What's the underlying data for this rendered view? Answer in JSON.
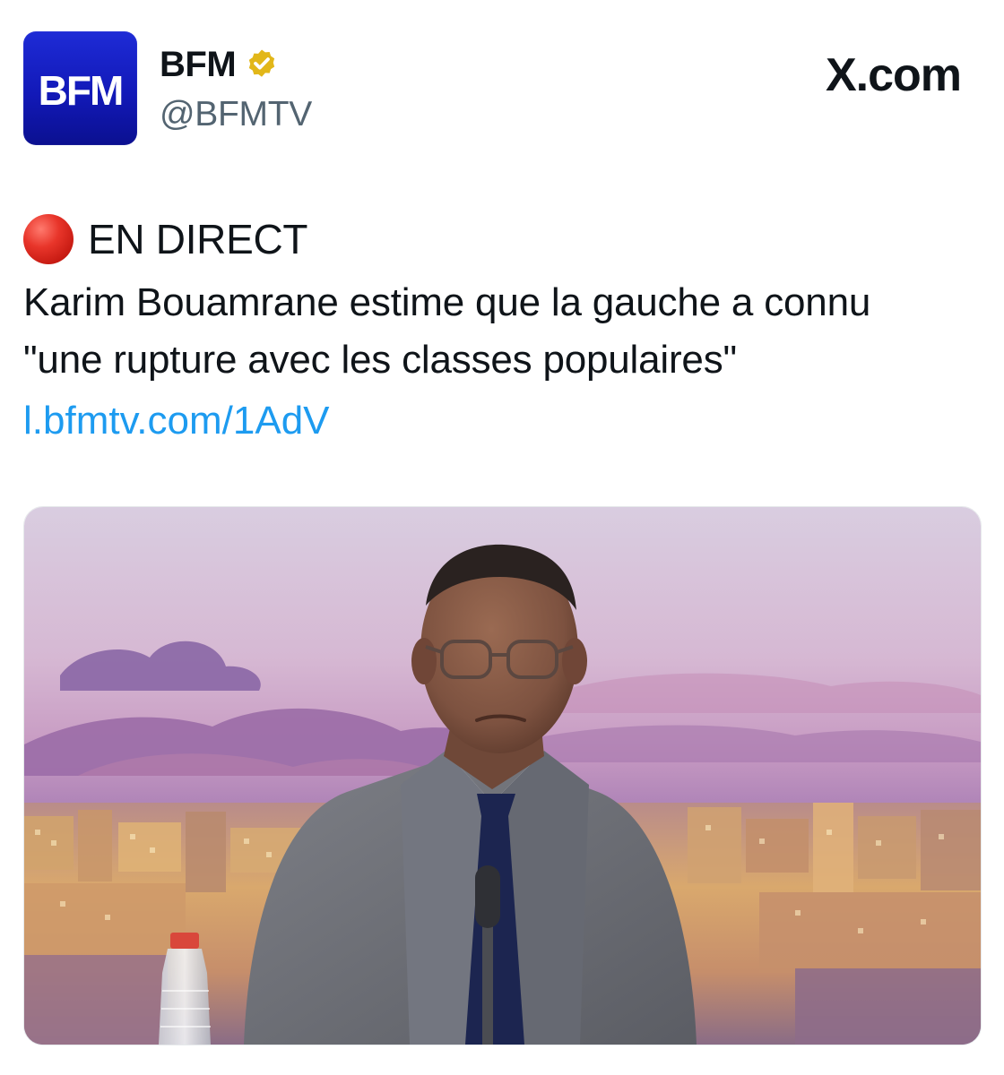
{
  "header": {
    "avatar_text": "BFM",
    "author_name": "BFM",
    "author_handle": "@BFMTV",
    "site_label": "X.com"
  },
  "tweet": {
    "live_label": "EN DIRECT",
    "text_line1": "Karim Bouamrane estime que la gauche a connu",
    "text_line2": "\"une rupture avec les classes populaires\"",
    "link": "l.bfmtv.com/1AdV"
  },
  "icons": {
    "verified": "verified-badge-icon",
    "live": "red-circle-icon",
    "brand": "x-logo-icon"
  },
  "colors": {
    "brand_blue": "#1219b8",
    "verified_gold": "#e2b719",
    "link_blue": "#1d9bf0",
    "live_red": "#e8352a"
  }
}
